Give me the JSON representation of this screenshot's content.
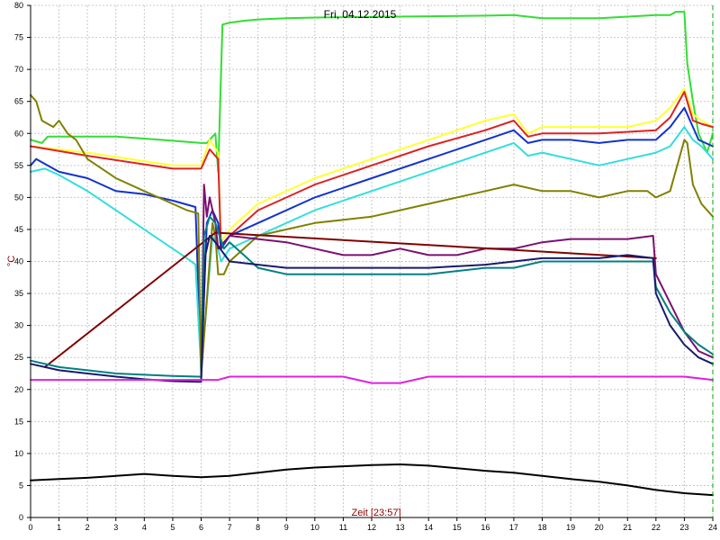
{
  "chart_data": {
    "type": "line",
    "title": "Fri, 04.12.2015",
    "xlabel": "Zeit [23:57]",
    "ylabel": "°C",
    "xlim": [
      0,
      24
    ],
    "ylim": [
      0,
      80
    ],
    "xticks": [
      0,
      1,
      2,
      3,
      4,
      5,
      6,
      7,
      8,
      9,
      10,
      11,
      12,
      13,
      14,
      15,
      16,
      17,
      18,
      19,
      20,
      21,
      22,
      23,
      24
    ],
    "yticks": [
      0,
      5,
      10,
      15,
      20,
      25,
      30,
      35,
      40,
      45,
      50,
      55,
      60,
      65,
      70,
      75,
      80
    ],
    "grid": true,
    "background": "#ffffff",
    "gridColor": "#c8c8c8",
    "series": [
      {
        "color": "#33dd33",
        "width": 2,
        "x": [
          0,
          0.4,
          0.6,
          3,
          4.6,
          6,
          6.2,
          6.5,
          6.6,
          6.75,
          7,
          7.5,
          8,
          9,
          10,
          12,
          14,
          16,
          17,
          18,
          19,
          20,
          22,
          22.5,
          22.7,
          23,
          23.1,
          23.3,
          23.5,
          23.8,
          24
        ],
        "y": [
          59,
          58.5,
          59.5,
          59.5,
          59,
          58.5,
          58.5,
          60,
          54,
          77,
          77.3,
          77.6,
          77.8,
          78,
          78.1,
          78.2,
          78.3,
          78.4,
          78.5,
          78,
          78,
          78,
          78.5,
          78.5,
          79,
          79,
          71,
          65,
          60,
          57,
          60
        ]
      },
      {
        "color": "#ffff33",
        "width": 2,
        "x": [
          0,
          2,
          5,
          6,
          6.3,
          6.6,
          6.7,
          7,
          8,
          10,
          12,
          14,
          16,
          17,
          17.5,
          18,
          20,
          21,
          22,
          22.5,
          23,
          23.3,
          23.6,
          24
        ],
        "y": [
          58,
          57,
          55,
          55,
          59,
          57,
          43,
          45,
          49,
          53,
          56,
          59,
          62,
          63,
          60,
          61,
          61,
          61,
          62,
          64,
          67,
          63,
          62,
          61
        ]
      },
      {
        "color": "#dd2222",
        "width": 2,
        "x": [
          0,
          2,
          5,
          6,
          6.3,
          6.6,
          6.7,
          7,
          8,
          10,
          12,
          14,
          16,
          17,
          17.5,
          18,
          20,
          22,
          22.5,
          23,
          23.3,
          23.6,
          24
        ],
        "y": [
          58,
          56.5,
          54.5,
          54.5,
          57.5,
          56,
          42,
          44,
          48,
          52,
          55,
          58,
          60.5,
          62,
          59.5,
          60,
          60,
          60.5,
          62.5,
          66.5,
          62,
          61.5,
          61
        ]
      },
      {
        "color": "#1133cc",
        "width": 2,
        "x": [
          0,
          0.2,
          1,
          2,
          3,
          4,
          5,
          5.8,
          6,
          6.2,
          6.4,
          6.6,
          6.7,
          7,
          8,
          10,
          12,
          14,
          16,
          17,
          17.5,
          18,
          19,
          20,
          21,
          22,
          22.5,
          23,
          23.3,
          23.5,
          24
        ],
        "y": [
          55,
          56,
          54,
          53,
          51,
          50.5,
          49.5,
          48.5,
          23,
          46,
          48,
          46,
          42,
          44,
          46,
          50,
          53,
          56,
          59,
          60.5,
          58.5,
          59,
          59,
          58.5,
          59,
          59,
          61,
          64,
          61,
          59,
          58
        ]
      },
      {
        "color": "#33dddd",
        "width": 2,
        "x": [
          0,
          0.5,
          1,
          2,
          3,
          4,
          5,
          5.5,
          5.8,
          6,
          6.4,
          6.6,
          6.7,
          7,
          8,
          10,
          12,
          14,
          16,
          17,
          17.5,
          18,
          19,
          20,
          21,
          22,
          22.5,
          23,
          23.3,
          23.6,
          24
        ],
        "y": [
          54,
          54.5,
          53.5,
          51,
          48,
          45,
          42,
          40.5,
          39.5,
          23,
          44,
          42,
          40,
          42,
          44,
          48,
          51,
          54,
          57,
          58.5,
          56.5,
          57,
          56,
          55,
          56,
          57,
          58,
          61,
          59,
          58,
          56
        ]
      },
      {
        "color": "#808000",
        "width": 2,
        "x": [
          0,
          0.2,
          0.4,
          0.6,
          0.8,
          1,
          1.3,
          1.6,
          2,
          3,
          4,
          5,
          5.5,
          5.9,
          6,
          6.4,
          6.5,
          6.6,
          6.8,
          7,
          8,
          9,
          10,
          12,
          14,
          16,
          17,
          18,
          19,
          20,
          21,
          21.7,
          22,
          22.5,
          23,
          23.1,
          23.3,
          23.6,
          24
        ],
        "y": [
          66,
          65,
          62,
          61.5,
          61,
          62,
          60,
          59,
          56,
          53,
          51,
          49,
          48,
          47.5,
          22,
          46,
          44,
          38,
          38,
          40,
          44,
          45,
          46,
          47,
          49,
          51,
          52,
          51,
          51,
          50,
          51,
          51,
          50,
          51,
          59,
          58.5,
          52,
          49,
          47
        ]
      },
      {
        "color": "#7b1070",
        "width": 2,
        "x": [
          6,
          6.1,
          6.2,
          6.3,
          6.5,
          6.6,
          7,
          8,
          9,
          10,
          11,
          12,
          13,
          14,
          15,
          16,
          17,
          18,
          19,
          20,
          21,
          21.9,
          22,
          22.5,
          23,
          23.5,
          24
        ],
        "y": [
          21.5,
          52,
          47,
          50,
          46,
          42,
          44,
          43.5,
          43,
          42,
          41,
          41,
          42,
          41,
          41,
          42,
          42,
          43,
          43.5,
          43.5,
          43.5,
          44,
          38,
          33.5,
          29,
          26,
          25
        ]
      },
      {
        "color": "#800000",
        "width": 2,
        "x": [
          0.5,
          6.5,
          22
        ],
        "y": [
          23.5,
          44.5,
          40.5
        ]
      },
      {
        "color": "#008080",
        "width": 2,
        "x": [
          0,
          1,
          2,
          3,
          4,
          5,
          5.9,
          6,
          6.1,
          6.3,
          6.5,
          6.8,
          7,
          7.5,
          8,
          9,
          10,
          12,
          14,
          16,
          17,
          18,
          19,
          20,
          21,
          21.9,
          22,
          22.5,
          23,
          23.5,
          24
        ],
        "y": [
          24.5,
          23.5,
          23,
          22.5,
          22.3,
          22.1,
          22,
          22,
          44,
          47,
          46,
          42,
          43,
          41,
          39,
          38,
          38,
          38,
          38,
          39,
          39,
          40,
          40,
          40,
          40,
          40,
          36,
          32,
          29,
          27,
          25.5
        ]
      },
      {
        "color": "#1a1a6e",
        "width": 2,
        "x": [
          0,
          1,
          2,
          3,
          4,
          5,
          5.9,
          6,
          6.15,
          6.3,
          6.5,
          7,
          8,
          9,
          10,
          12,
          14,
          16,
          17,
          18,
          19,
          20,
          21,
          21.9,
          22,
          22.5,
          23,
          23.5,
          24
        ],
        "y": [
          24,
          23,
          22.5,
          22,
          21.6,
          21.3,
          21.2,
          21.2,
          41,
          44,
          43,
          40,
          39.5,
          39,
          39,
          39,
          39,
          39.5,
          40,
          40.5,
          40.5,
          40.5,
          41,
          40.5,
          35,
          30,
          27,
          25,
          24
        ]
      },
      {
        "color": "#dd22dd",
        "width": 2,
        "x": [
          0,
          6,
          6.6,
          7,
          8,
          9,
          10,
          11,
          12,
          13,
          14,
          15,
          16,
          17,
          18,
          19,
          20,
          21,
          22,
          23,
          24
        ],
        "y": [
          21.5,
          21.5,
          21.5,
          22,
          22,
          22,
          22,
          22,
          21,
          21,
          22,
          22,
          22,
          22,
          22,
          22,
          22,
          22,
          22,
          22,
          21.5
        ]
      },
      {
        "color": "#000000",
        "width": 2,
        "x": [
          0,
          1,
          2,
          3,
          4,
          5,
          6,
          7,
          8,
          9,
          10,
          11,
          12,
          13,
          14,
          15,
          16,
          17,
          18,
          19,
          20,
          21,
          22,
          23,
          24
        ],
        "y": [
          5.8,
          6,
          6.2,
          6.5,
          6.8,
          6.5,
          6.3,
          6.5,
          7,
          7.5,
          7.8,
          8,
          8.2,
          8.3,
          8.1,
          7.7,
          7.3,
          7,
          6.5,
          6,
          5.6,
          5,
          4.3,
          3.8,
          3.5
        ]
      }
    ]
  }
}
